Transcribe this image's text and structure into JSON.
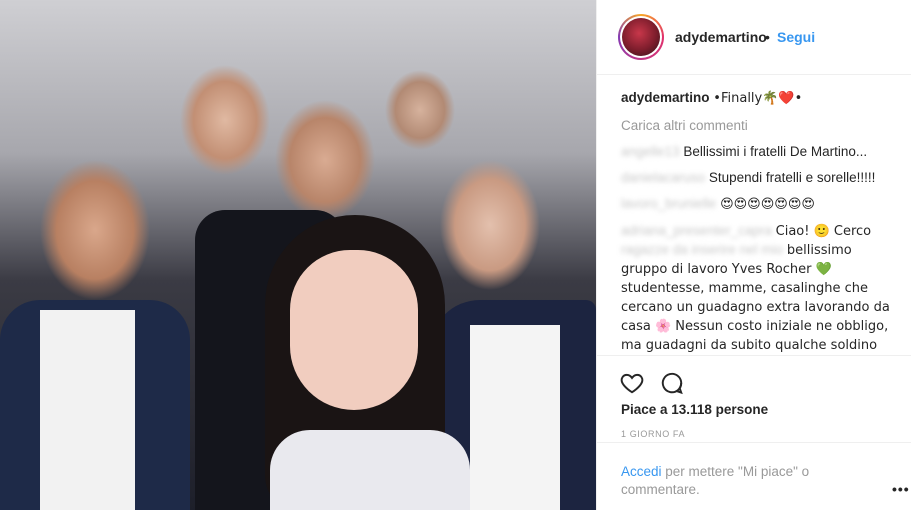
{
  "post": {
    "username": "adydemartino",
    "follow_separator": "•",
    "follow_label": "Segui",
    "caption_text": "•Finally🌴❤️•",
    "load_more": "Carica altri commenti",
    "comments": [
      {
        "user": "angelle13",
        "text": "Bellissimi i fratelli De Martino..."
      },
      {
        "user": "danielacaruso",
        "text": "Stupendi fratelli e sorelle!!!!!"
      },
      {
        "user": "lavoro_brunielle",
        "text": "😍😍😍😍😍😍😍"
      },
      {
        "user": "adriana_presenter_capra",
        "text": "Ciao! 🙂 Cerco"
      },
      {
        "blurred_prefix": "ragazze da inserire nel mio",
        "text": "bellissimo gruppo di lavoro Yves Rocher 💚 studentesse, mamme, casalinghe che cercano un guadagno extra lavorando da casa 🌸 Nessun costo iniziale ne obbligo, ma guadagni da subito qualche soldino ed hai"
      }
    ],
    "likes": "Piace a 13.118 persone",
    "time": "1 giorno fa",
    "add_comment": {
      "login_link": "Accedi",
      "rest": " per mettere \"Mi piace\" o commentare.",
      "more_icon": "•••"
    }
  },
  "icons": {
    "like": "heart-icon",
    "comment": "comment-bubble-icon",
    "more": "more-options-icon"
  },
  "colors": {
    "accent": "#3897f0",
    "muted": "#999999",
    "text": "#262626",
    "border": "#efefef"
  }
}
